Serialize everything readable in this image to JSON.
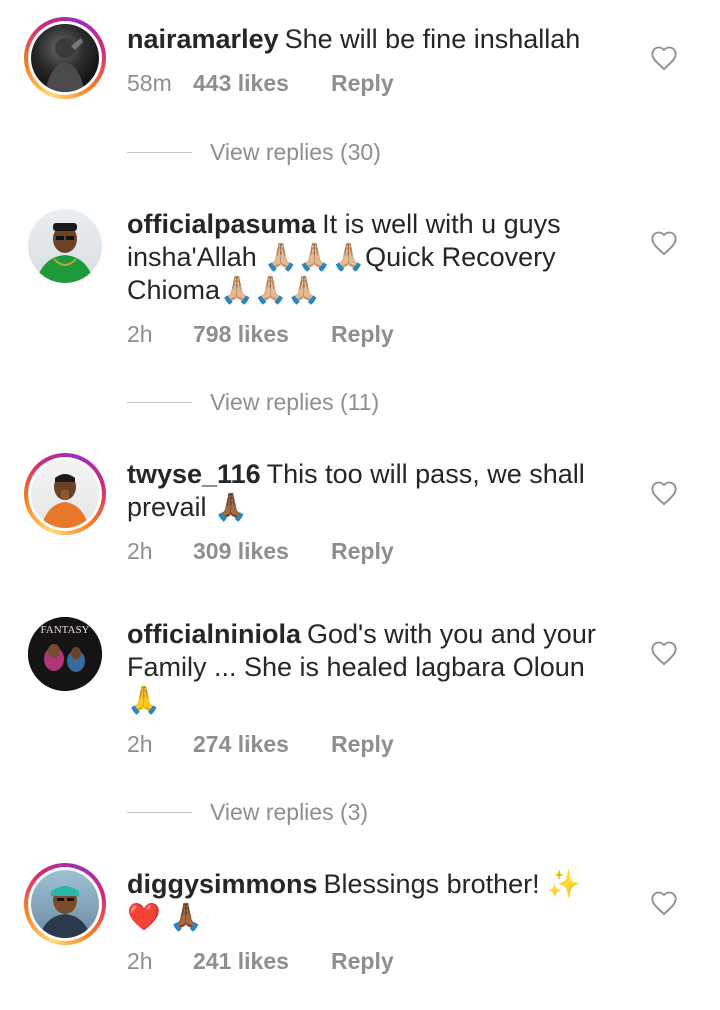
{
  "comments": [
    {
      "username": "nairamarley",
      "text": "She will be fine inshallah",
      "emoji": "",
      "time": "58m",
      "likes": "443 likes",
      "reply": "Reply",
      "view_replies": "View replies (30)"
    },
    {
      "username": "officialpasuma",
      "text": "It is well with u guys insha'Allah ",
      "emoji_mid": "🙏🏼🙏🏼🙏🏼",
      "text2": "Quick Recovery Chioma",
      "emoji": "🙏🏼🙏🏼🙏🏼",
      "time": "2h",
      "likes": "798 likes",
      "reply": "Reply",
      "view_replies": "View replies (11)"
    },
    {
      "username": "twyse_116",
      "text": "This too will pass, we shall prevail ",
      "emoji": "🙏🏾",
      "time": "2h",
      "likes": "309 likes",
      "reply": "Reply"
    },
    {
      "username": "officialniniola",
      "text": "God's with you and your Family ... She is healed lagbara Oloun ",
      "emoji": "🙏",
      "time": "2h",
      "likes": "274 likes",
      "reply": "Reply",
      "view_replies": "View replies (3)"
    },
    {
      "username": "diggysimmons",
      "text": "Blessings brother! ",
      "emoji": "✨❤️ 🙏🏾",
      "time": "2h",
      "likes": "241 likes",
      "reply": "Reply"
    }
  ],
  "avatar_labels": {
    "niniola_cover": "FANTASY"
  },
  "colors": {
    "username": "#262626",
    "meta": "#8e8e8e",
    "divider": "#c7c7c7",
    "story_ring": "#d62976"
  }
}
